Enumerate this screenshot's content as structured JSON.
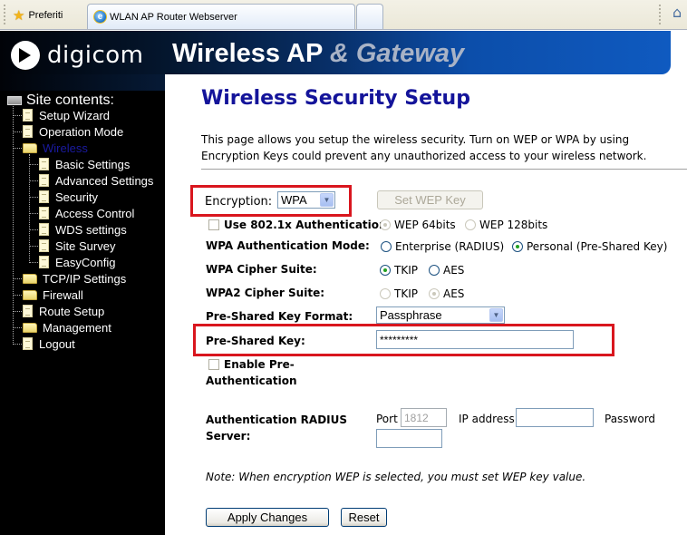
{
  "browser": {
    "favorites_label": "Preferiti",
    "active_tab_title": "WLAN AP Router Webserver",
    "home_icon": "home-icon"
  },
  "header": {
    "logo_text": "digicom",
    "brand_main": "Wireless AP ",
    "brand_sub": "& Gateway"
  },
  "sidebar": {
    "title": "Site contents:",
    "items": [
      {
        "label": "Setup Wizard",
        "type": "page"
      },
      {
        "label": "Operation Mode",
        "type": "page"
      },
      {
        "label": "Wireless",
        "type": "folder-open",
        "active": true
      },
      {
        "label": "Basic Settings",
        "type": "page"
      },
      {
        "label": "Advanced Settings",
        "type": "page"
      },
      {
        "label": "Security",
        "type": "page"
      },
      {
        "label": "Access Control",
        "type": "page"
      },
      {
        "label": "WDS settings",
        "type": "page"
      },
      {
        "label": "Site Survey",
        "type": "page"
      },
      {
        "label": "EasyConfig",
        "type": "page"
      },
      {
        "label": "TCP/IP Settings",
        "type": "folder"
      },
      {
        "label": "Firewall",
        "type": "folder"
      },
      {
        "label": "Route Setup",
        "type": "page"
      },
      {
        "label": "Management",
        "type": "folder"
      },
      {
        "label": "Logout",
        "type": "page"
      }
    ]
  },
  "main": {
    "title": "Wireless Security Setup",
    "description": "This page allows you setup the wireless security. Turn on WEP or WPA by using Encryption Keys could prevent any unauthorized access to your wireless network.",
    "encryption": {
      "label": "Encryption:",
      "value": "WPA"
    },
    "set_wep_key_button": "Set WEP Key",
    "use_8021x": {
      "label": "Use 802.1x Authentication",
      "checked": false
    },
    "wep_bits": {
      "options": [
        "WEP 64bits",
        "WEP 128bits"
      ],
      "selected": "WEP 64bits",
      "disabled": true
    },
    "wpa_auth_mode": {
      "label": "WPA Authentication Mode:",
      "options": [
        "Enterprise (RADIUS)",
        "Personal (Pre-Shared Key)"
      ],
      "selected": "Personal (Pre-Shared Key)"
    },
    "wpa_cipher": {
      "label": "WPA Cipher Suite:",
      "options": [
        "TKIP",
        "AES"
      ],
      "selected": "TKIP"
    },
    "wpa2_cipher": {
      "label": "WPA2 Cipher Suite:",
      "options": [
        "TKIP",
        "AES"
      ],
      "selected": "AES",
      "disabled": true
    },
    "psk_format": {
      "label": "Pre-Shared Key Format:",
      "value": "Passphrase"
    },
    "psk": {
      "label": "Pre-Shared Key:",
      "value": "*********"
    },
    "pre_auth": {
      "label_line1": "Enable Pre-",
      "label_line2": "Authentication",
      "checked": false
    },
    "radius": {
      "label_line1": "Authentication RADIUS",
      "label_line2": "Server:",
      "port_label": "Port",
      "port_value": "1812",
      "ip_label": "IP address",
      "ip_value": "",
      "password_label": "Password",
      "password_value": ""
    },
    "note": "Note: When encryption WEP is selected, you must set WEP key value.",
    "apply_button": "Apply Changes",
    "reset_button": "Reset"
  }
}
